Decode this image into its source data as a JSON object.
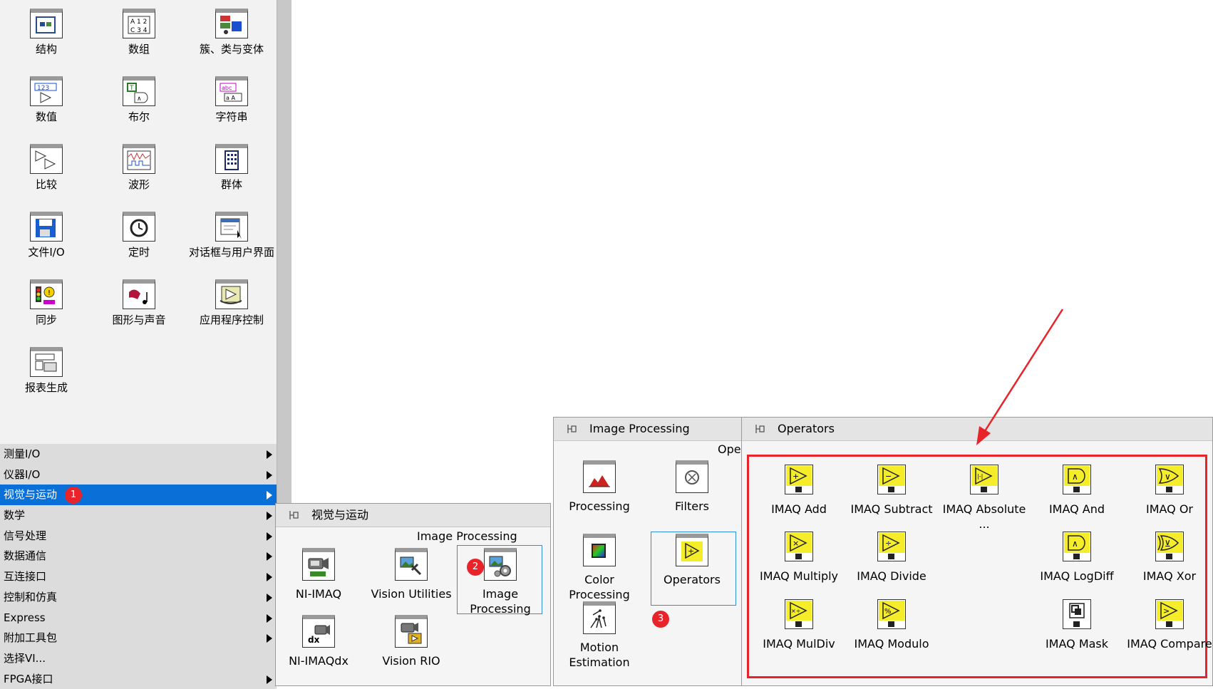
{
  "palette": {
    "tiles": [
      {
        "label": "结构",
        "icon": "structure-icon"
      },
      {
        "label": "数组",
        "icon": "array-icon"
      },
      {
        "label": "簇、类与变体",
        "icon": "cluster-icon"
      },
      {
        "label": "数值",
        "icon": "numeric-icon"
      },
      {
        "label": "布尔",
        "icon": "boolean-icon"
      },
      {
        "label": "字符串",
        "icon": "string-icon"
      },
      {
        "label": "比较",
        "icon": "comparison-icon"
      },
      {
        "label": "波形",
        "icon": "waveform-icon"
      },
      {
        "label": "群体",
        "icon": "group-icon"
      },
      {
        "label": "文件I/O",
        "icon": "file-io-icon"
      },
      {
        "label": "定时",
        "icon": "timing-icon"
      },
      {
        "label": "对话框与用户界面",
        "icon": "dialog-icon"
      },
      {
        "label": "同步",
        "icon": "sync-icon"
      },
      {
        "label": "图形与声音",
        "icon": "graphics-sound-icon"
      },
      {
        "label": "应用程序控制",
        "icon": "app-control-icon"
      },
      {
        "label": "报表生成",
        "icon": "report-icon"
      }
    ],
    "categories": [
      {
        "label": "测量I/O",
        "selected": false
      },
      {
        "label": "仪器I/O",
        "selected": false
      },
      {
        "label": "视觉与运动",
        "selected": true
      },
      {
        "label": "数学",
        "selected": false
      },
      {
        "label": "信号处理",
        "selected": false
      },
      {
        "label": "数据通信",
        "selected": false
      },
      {
        "label": "互连接口",
        "selected": false
      },
      {
        "label": "控制和仿真",
        "selected": false
      },
      {
        "label": "Express",
        "selected": false
      },
      {
        "label": "附加工具包",
        "selected": false
      },
      {
        "label": "选择VI...",
        "selected": false
      },
      {
        "label": "FPGA接口",
        "selected": false
      }
    ]
  },
  "badges": {
    "b1": "1",
    "b2": "2",
    "b3": "3"
  },
  "vision_panel": {
    "title": "视觉与运动",
    "header_label": "Image Processing",
    "items": [
      {
        "label": "NI-IMAQ",
        "icon": "camera-icon"
      },
      {
        "label": "Vision Utilities",
        "icon": "vision-utilities-icon"
      },
      {
        "label": "Image Processing",
        "icon": "image-processing-icon"
      },
      {
        "label": "NI-IMAQdx",
        "icon": "imaqdx-icon"
      },
      {
        "label": "Vision RIO",
        "icon": "vision-rio-icon"
      }
    ]
  },
  "image_panel": {
    "title": "Image Processing",
    "header_label": "Ope",
    "items": [
      {
        "label": "Processing",
        "icon": "processing-icon"
      },
      {
        "label": "Filters",
        "icon": "filters-icon"
      },
      {
        "label": "Color Processing",
        "icon": "color-processing-icon"
      },
      {
        "label": "Operators",
        "icon": "operators-icon"
      },
      {
        "label": "Motion Estimation",
        "icon": "motion-estimation-icon"
      }
    ]
  },
  "operators_panel": {
    "title": "Operators",
    "items": [
      {
        "label": "IMAQ Add",
        "symbol": "+"
      },
      {
        "label": "IMAQ Subtract",
        "symbol": "−"
      },
      {
        "label": "IMAQ Absolute ...",
        "symbol": "|-|"
      },
      {
        "label": "IMAQ And",
        "symbol": "∧"
      },
      {
        "label": "IMAQ Or",
        "symbol": "∨"
      },
      {
        "label": "IMAQ Multiply",
        "symbol": "×"
      },
      {
        "label": "IMAQ Divide",
        "symbol": "÷"
      },
      {
        "label": "IMAQ LogDiff",
        "symbol": "∧"
      },
      {
        "label": "IMAQ Xor",
        "symbol": "⊻"
      },
      {
        "label": "IMAQ MulDiv",
        "symbol": "×÷"
      },
      {
        "label": "IMAQ Modulo",
        "symbol": "%"
      },
      {
        "label": "IMAQ Mask",
        "symbol": "▣"
      },
      {
        "label": "IMAQ Compare",
        "symbol": ">"
      }
    ]
  },
  "colors": {
    "selection": "#0a6fd6",
    "highlight_box": "#e8242a",
    "badge": "#e8242a",
    "operator_fill": "#f5ec2a"
  }
}
